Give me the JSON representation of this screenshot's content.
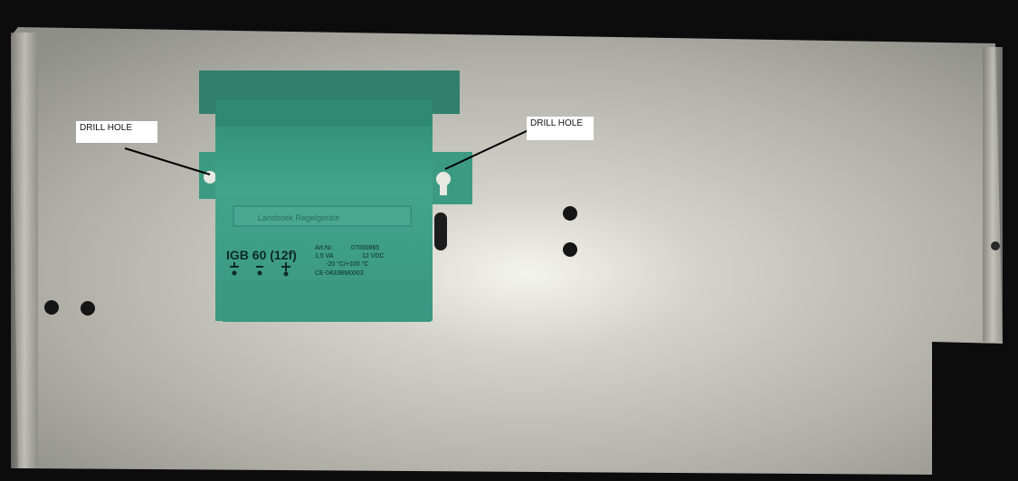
{
  "annotations": {
    "left_label": "DRILL HOLE",
    "right_label": "DRILL HOLE"
  },
  "device": {
    "brand": "Landsoek Regelgeräte",
    "model": "IGB 60 (12f)",
    "art_nr_label": "Art.Nr.",
    "art_nr_value": "07000865",
    "power": "1,5 VA",
    "voltage": "12 VDC",
    "temp_range": "-20 °C/+100 °C",
    "ce_mark": "CE-0433BM0003",
    "symbols": [
      "earth",
      "minus",
      "plus"
    ]
  },
  "colors": {
    "background": "#0c0c0c",
    "plate": "#b9b9b2",
    "device_green": "#3f9e86",
    "device_dark": "#2f7f6b",
    "label_bg": "#ffffff",
    "leader_line": "#000000"
  }
}
